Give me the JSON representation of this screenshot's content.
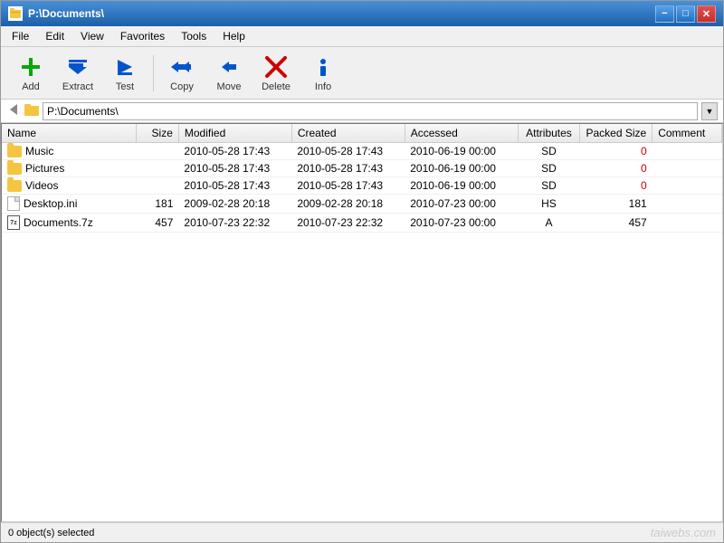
{
  "window": {
    "title": "P:\\Documents\\",
    "controls": {
      "minimize": "−",
      "maximize": "□",
      "close": "✕"
    }
  },
  "menu": {
    "items": [
      "File",
      "Edit",
      "View",
      "Favorites",
      "Tools",
      "Help"
    ]
  },
  "toolbar": {
    "buttons": [
      {
        "id": "add",
        "label": "Add",
        "icon": "add-icon"
      },
      {
        "id": "extract",
        "label": "Extract",
        "icon": "extract-icon"
      },
      {
        "id": "test",
        "label": "Test",
        "icon": "test-icon"
      },
      {
        "id": "copy",
        "label": "Copy",
        "icon": "copy-icon"
      },
      {
        "id": "move",
        "label": "Move",
        "icon": "move-icon"
      },
      {
        "id": "delete",
        "label": "Delete",
        "icon": "delete-icon"
      },
      {
        "id": "info",
        "label": "Info",
        "icon": "info-icon"
      }
    ]
  },
  "address_bar": {
    "path": "P:\\Documents\\"
  },
  "table": {
    "columns": [
      "Name",
      "Size",
      "Modified",
      "Created",
      "Accessed",
      "Attributes",
      "Packed Size",
      "Comment"
    ],
    "rows": [
      {
        "type": "folder",
        "name": "Music",
        "size": "",
        "modified": "2010-05-28 17:43",
        "created": "2010-05-28 17:43",
        "accessed": "2010-06-19 00:00",
        "attributes": "SD",
        "packed_size": "0",
        "comment": "",
        "packed_color": "red"
      },
      {
        "type": "folder",
        "name": "Pictures",
        "size": "",
        "modified": "2010-05-28 17:43",
        "created": "2010-05-28 17:43",
        "accessed": "2010-06-19 00:00",
        "attributes": "SD",
        "packed_size": "0",
        "comment": "",
        "packed_color": "red"
      },
      {
        "type": "folder",
        "name": "Videos",
        "size": "",
        "modified": "2010-05-28 17:43",
        "created": "2010-05-28 17:43",
        "accessed": "2010-06-19 00:00",
        "attributes": "SD",
        "packed_size": "0",
        "comment": "",
        "packed_color": "red"
      },
      {
        "type": "ini",
        "name": "Desktop.ini",
        "size": "181",
        "modified": "2009-02-28 20:18",
        "created": "2009-02-28 20:18",
        "accessed": "2010-07-23 00:00",
        "attributes": "HS",
        "packed_size": "181",
        "comment": "",
        "packed_color": "normal"
      },
      {
        "type": "7z",
        "name": "Documents.7z",
        "size": "457",
        "modified": "2010-07-23 22:32",
        "created": "2010-07-23 22:32",
        "accessed": "2010-07-23 00:00",
        "attributes": "A",
        "packed_size": "457",
        "comment": "",
        "packed_color": "normal"
      }
    ]
  },
  "status": {
    "text": "0 object(s) selected",
    "watermark": "taiwebs.com"
  }
}
